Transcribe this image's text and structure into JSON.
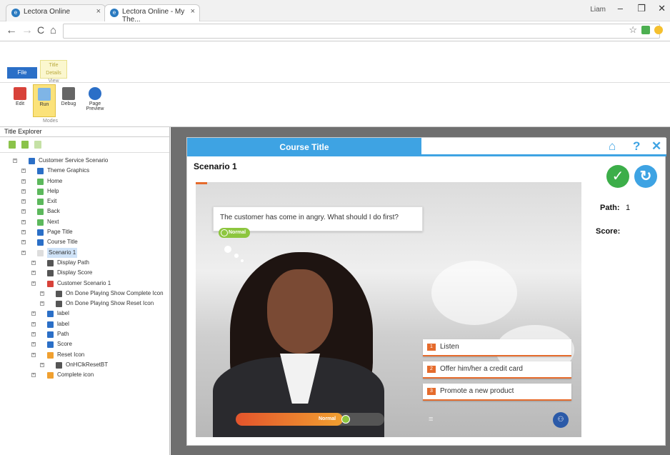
{
  "browser": {
    "tabs": [
      {
        "label": "Lectora Online",
        "close": "×"
      },
      {
        "label": "Lectora Online - My The...",
        "close": "×"
      }
    ],
    "user": "Liam",
    "window_controls": [
      "–",
      "❐",
      "✕"
    ],
    "nav": {
      "back": "←",
      "forward": "→",
      "reload": "C",
      "home": "⌂"
    },
    "address": ""
  },
  "ribbon": {
    "tabs": {
      "file": "File",
      "view": "View"
    },
    "view_tab_caption": "Title Details",
    "buttons": [
      {
        "label": "Edit",
        "icon": "edit-icon",
        "color": "#d8423a"
      },
      {
        "label": "Run",
        "icon": "run-icon",
        "color": "#7fb5e6"
      },
      {
        "label": "Debug",
        "icon": "debug-icon",
        "color": "#666666"
      },
      {
        "label": "Page Preview",
        "icon": "page-preview-icon",
        "color": "#2b6fc7"
      }
    ],
    "group_label": "Modes"
  },
  "explorer": {
    "title": "Title Explorer",
    "tree": [
      {
        "label": "Customer Service Scenario",
        "level": 0,
        "icon": "title-icon",
        "color": "#2b6fc7"
      },
      {
        "label": "Theme Graphics",
        "level": 1,
        "icon": "graphics-icon",
        "color": "#2b6fc7"
      },
      {
        "label": "Home",
        "level": 1,
        "icon": "button-icon",
        "color": "#5cb85c"
      },
      {
        "label": "Help",
        "level": 1,
        "icon": "button-icon",
        "color": "#5cb85c"
      },
      {
        "label": "Exit",
        "level": 1,
        "icon": "button-icon",
        "color": "#5cb85c"
      },
      {
        "label": "Back",
        "level": 1,
        "icon": "button-icon",
        "color": "#5cb85c"
      },
      {
        "label": "Next",
        "level": 1,
        "icon": "button-icon",
        "color": "#5cb85c"
      },
      {
        "label": "Page Title",
        "level": 1,
        "icon": "text-icon",
        "color": "#2b6fc7"
      },
      {
        "label": "Course Title",
        "level": 1,
        "icon": "text-icon",
        "color": "#2b6fc7"
      },
      {
        "label": "Scenario 1",
        "level": 1,
        "icon": "page-icon",
        "color": "#dddddd",
        "selected": true
      },
      {
        "label": "Display Path",
        "level": 2,
        "icon": "action-icon",
        "color": "#555555"
      },
      {
        "label": "Display Score",
        "level": 2,
        "icon": "action-icon",
        "color": "#555555"
      },
      {
        "label": "Customer Scenario 1",
        "level": 2,
        "icon": "scenario-icon",
        "color": "#d8423a"
      },
      {
        "label": "On Done Playing Show Complete Icon",
        "level": 3,
        "icon": "action-icon",
        "color": "#555555"
      },
      {
        "label": "On Done Playing Show Reset Icon",
        "level": 3,
        "icon": "action-icon",
        "color": "#555555"
      },
      {
        "label": "label",
        "level": 2,
        "icon": "text-icon",
        "color": "#2b6fc7"
      },
      {
        "label": "label",
        "level": 2,
        "icon": "text-icon",
        "color": "#2b6fc7"
      },
      {
        "label": "Path",
        "level": 2,
        "icon": "text-icon",
        "color": "#2b6fc7"
      },
      {
        "label": "Score",
        "level": 2,
        "icon": "text-icon",
        "color": "#2b6fc7"
      },
      {
        "label": "Reset Icon",
        "level": 2,
        "icon": "image-icon",
        "color": "#f0a030"
      },
      {
        "label": "OnHClkResetBT",
        "level": 3,
        "icon": "action-icon",
        "color": "#555555"
      },
      {
        "label": "Complete icon",
        "level": 2,
        "icon": "image-icon",
        "color": "#f0a030"
      }
    ]
  },
  "player": {
    "course_title": "Course Title",
    "header_icons": [
      "home-icon",
      "help-icon",
      "close-icon"
    ],
    "header_glyphs": {
      "home": "⌂",
      "help": "?",
      "close": "✕"
    },
    "scenario_title": "Scenario 1",
    "path_label": "Path:",
    "path_value": "1",
    "score_label": "Score:",
    "check_glyph": "✓",
    "reset_glyph": "↻",
    "speech": "The customer has come in angry. What should I do first?",
    "mood_badge": "Normal",
    "choices": [
      {
        "num": "1",
        "label": "Listen"
      },
      {
        "num": "2",
        "label": "Offer him/her a credit card"
      },
      {
        "num": "3",
        "label": "Promote a new product"
      }
    ],
    "meter_label": "Normal",
    "meter_level_percent": 72,
    "menu_glyph": "≡",
    "corner_glyph": "⚇",
    "accent": "#3ea3e3",
    "choice_accent": "#e56b2c"
  }
}
